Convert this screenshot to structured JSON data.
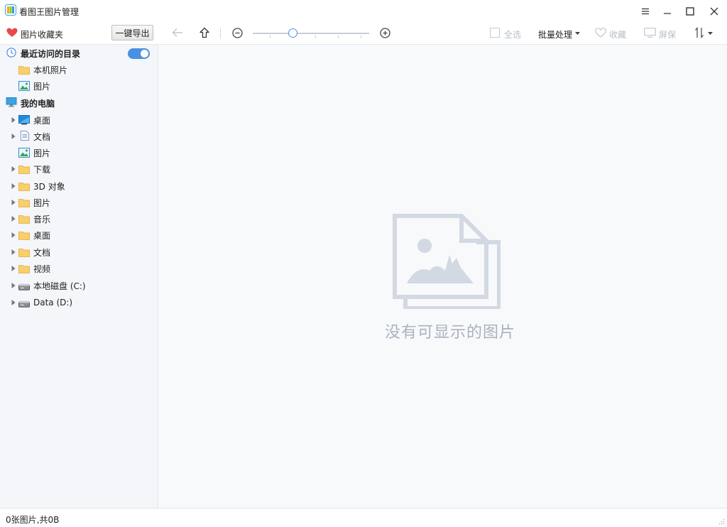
{
  "window": {
    "title": "看图王图片管理",
    "controls": [
      "menu-icon",
      "minimize-icon",
      "maximize-icon",
      "close-icon"
    ]
  },
  "toolbar": {
    "favorites_label": "图片收藏夹",
    "export_label": "一键导出",
    "select_all_label": "全选",
    "batch_label": "批量处理",
    "collect_label": "收藏",
    "screensaver_label": "屏保",
    "zoom_level_fraction": 0.35
  },
  "sidebar": {
    "recent_header": "最近访问的目录",
    "recent_toggle_on": true,
    "recent_items": [
      {
        "label": "本机照片",
        "icon": "folder-icon"
      },
      {
        "label": "图片",
        "icon": "image-icon"
      }
    ],
    "computer_header": "我的电脑",
    "computer_items": [
      {
        "label": "桌面",
        "icon": "desktop-icon",
        "expandable": true
      },
      {
        "label": "文档",
        "icon": "document-icon",
        "expandable": true
      },
      {
        "label": "图片",
        "icon": "image-icon",
        "expandable": false
      },
      {
        "label": "下载",
        "icon": "folder-icon",
        "expandable": true
      },
      {
        "label": "3D 对象",
        "icon": "folder-icon",
        "expandable": true
      },
      {
        "label": "图片",
        "icon": "folder-icon",
        "expandable": true
      },
      {
        "label": "音乐",
        "icon": "folder-icon",
        "expandable": true
      },
      {
        "label": "桌面",
        "icon": "folder-icon",
        "expandable": true
      },
      {
        "label": "文档",
        "icon": "folder-icon",
        "expandable": true
      },
      {
        "label": "视频",
        "icon": "folder-icon",
        "expandable": true
      },
      {
        "label": "本地磁盘 (C:)",
        "icon": "drive-icon",
        "expandable": true
      },
      {
        "label": "Data (D:)",
        "icon": "drive-icon",
        "expandable": true
      }
    ]
  },
  "main": {
    "empty_message": "没有可显示的图片"
  },
  "status": {
    "text": "0张图片,共0B"
  },
  "colors": {
    "accent": "#4a90e2",
    "sidebar_bg": "#f4f6f9",
    "main_bg": "#f7f9fb",
    "placeholder": "#d3d9e2",
    "heart": "#e84a4a",
    "folder": "#f9cf6a"
  }
}
